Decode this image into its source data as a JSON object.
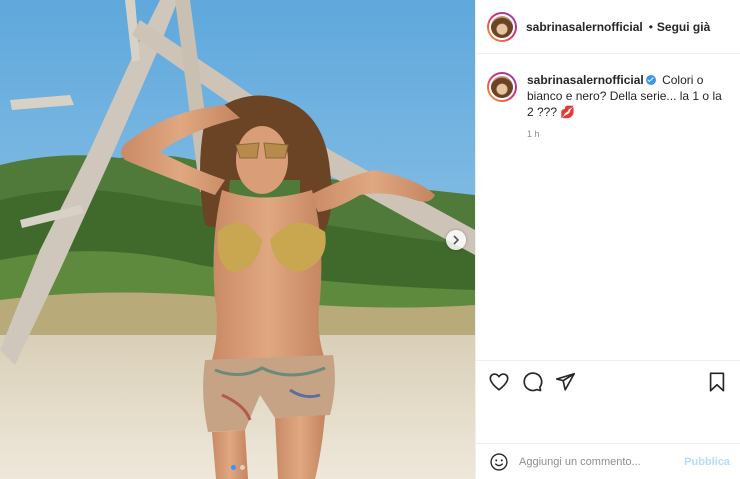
{
  "post": {
    "header": {
      "username": "sabrinasalernofficial",
      "separator": "•",
      "follow_label": "Segui già"
    },
    "caption": {
      "username": "sabrinasalernofficial",
      "text": "Colori o bianco e nero? Della serie... la 1 o la 2 ??? 💋",
      "time": "1 h"
    },
    "actions": {
      "like_icon": "heart-icon",
      "comment_icon": "comment-icon",
      "share_icon": "send-icon",
      "save_icon": "bookmark-icon"
    },
    "comment_box": {
      "placeholder": "Aggiungi un commento...",
      "publish_label": "Pubblica"
    },
    "carousel": {
      "total": 2,
      "current": 1
    },
    "colors": {
      "accent": "#3897f0",
      "publish_disabled": "#b2dffc",
      "border": "#efefef",
      "muted": "#8e8e8e"
    }
  }
}
